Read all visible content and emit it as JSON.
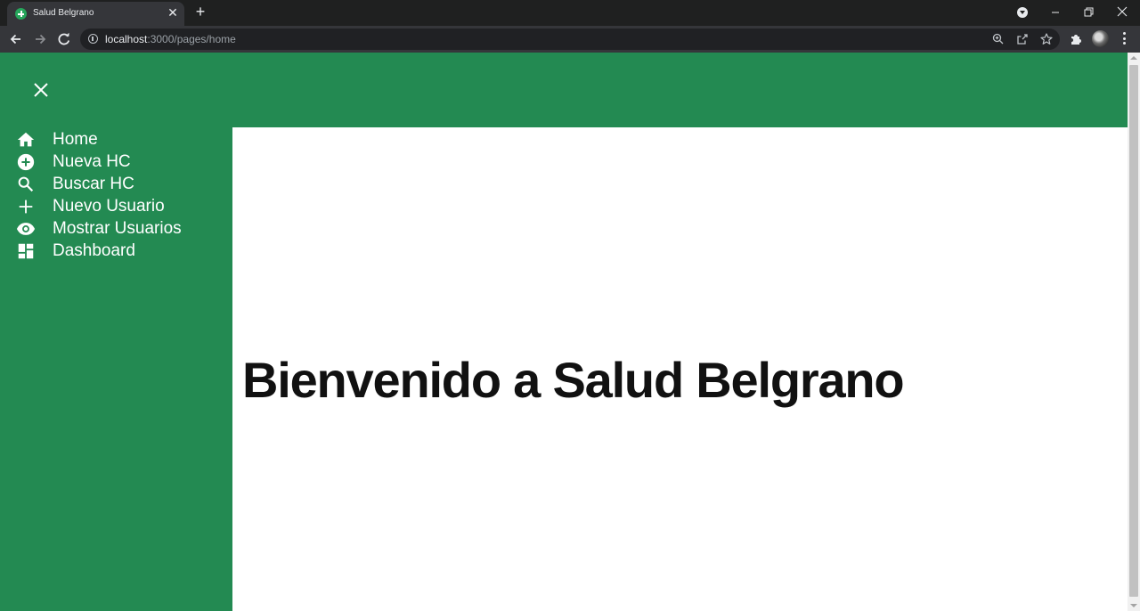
{
  "browser": {
    "tab_title": "Salud Belgrano",
    "tab_close_glyph": "✕",
    "new_tab_glyph": "+",
    "url_host": "localhost",
    "url_rest": ":3000/pages/home",
    "icons": [
      "back-arrow-icon",
      "forward-arrow-icon",
      "reload-icon",
      "info-icon",
      "zoom-icon",
      "share-icon",
      "star-icon",
      "extensions-icon",
      "kebab-menu-icon"
    ]
  },
  "app": {
    "accent_color": "#238a52",
    "close_menu_icon": "close-icon",
    "sidebar": {
      "items": [
        {
          "label": "Home",
          "icon": "home-icon"
        },
        {
          "label": "Nueva HC",
          "icon": "add-circle-icon"
        },
        {
          "label": "Buscar HC",
          "icon": "search-icon"
        },
        {
          "label": "Nuevo Usuario",
          "icon": "plus-icon"
        },
        {
          "label": "Mostrar Usuarios",
          "icon": "eye-icon"
        },
        {
          "label": "Dashboard",
          "icon": "dashboard-icon"
        }
      ]
    },
    "main": {
      "heading": "Bienvenido a Salud Belgrano"
    }
  }
}
